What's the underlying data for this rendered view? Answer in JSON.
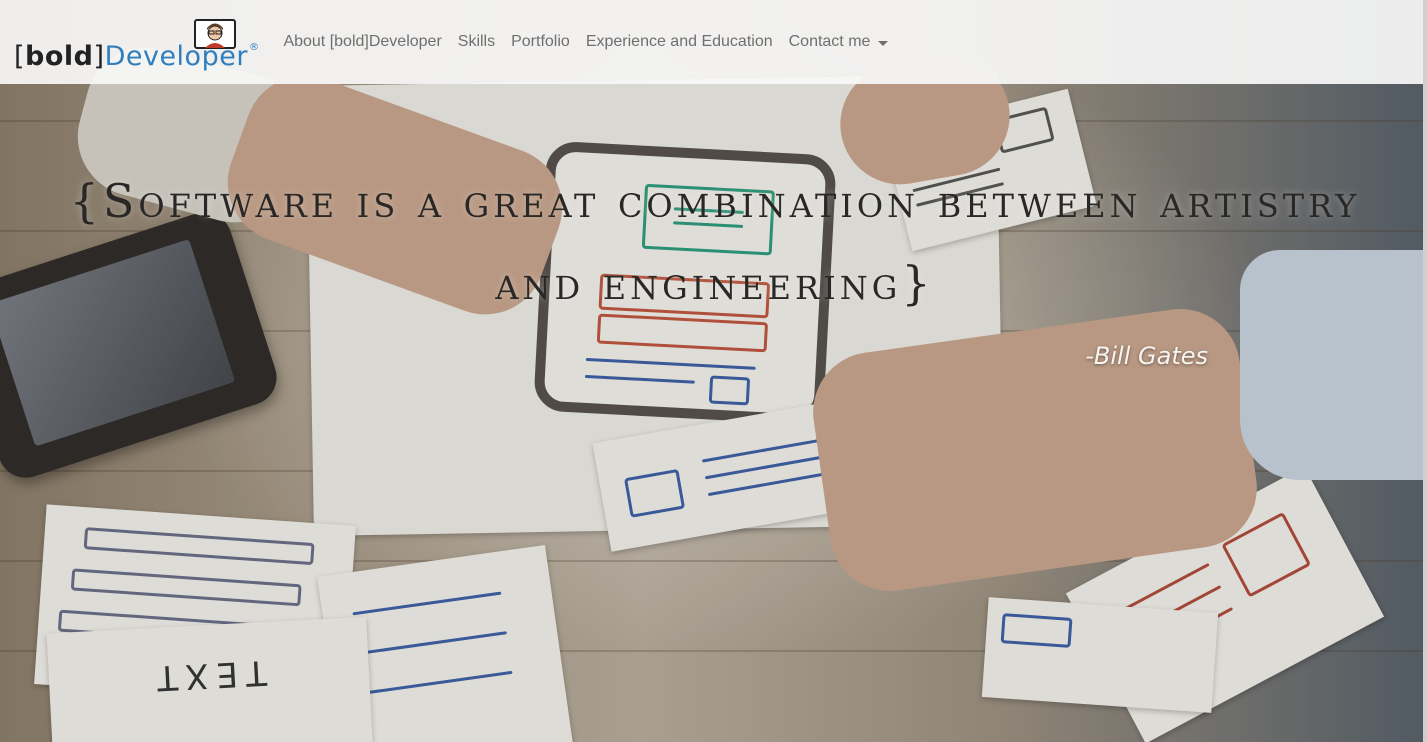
{
  "brand": {
    "bracket_open": "[",
    "bold": "bold",
    "bracket_close": "]",
    "name": "Developer",
    "registered": "®",
    "avatar_icon": "developer-avatar-icon"
  },
  "nav": {
    "items": [
      {
        "label": "About [bold]Developer"
      },
      {
        "label": "Skills"
      },
      {
        "label": "Portfolio"
      },
      {
        "label": "Experience and Education"
      },
      {
        "label": "Contact me",
        "dropdown": true
      }
    ]
  },
  "hero": {
    "quote_line1": "{Software is a great combination between artistry",
    "quote_line2": "and engineering}",
    "author": "-Bill Gates",
    "sketch_text": "TEXT"
  },
  "colors": {
    "brand_blue": "#2f7fbf",
    "nav_text": "#6f6f6f",
    "quote_text": "#2a2826",
    "author_text": "#f7f5f2"
  }
}
